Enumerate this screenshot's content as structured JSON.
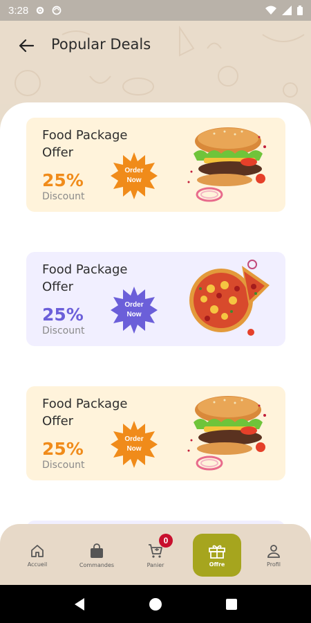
{
  "status_bar": {
    "time": "3:28"
  },
  "header": {
    "title": "Popular Deals"
  },
  "deals": [
    {
      "title": "Food Package Offer",
      "percent": "25%",
      "discount_label": "Discount",
      "badge_line1": "Order",
      "badge_line2": "Now",
      "theme": "orange",
      "food": "burger"
    },
    {
      "title": "Food Package Offer",
      "percent": "25%",
      "discount_label": "Discount",
      "badge_line1": "Order",
      "badge_line2": "Now",
      "theme": "purple",
      "food": "pizza"
    },
    {
      "title": "Food Package Offer",
      "percent": "25%",
      "discount_label": "Discount",
      "badge_line1": "Order",
      "badge_line2": "Now",
      "theme": "orange",
      "food": "burger"
    }
  ],
  "bottom_nav": {
    "items": [
      {
        "label": "Accueil",
        "icon": "home-icon"
      },
      {
        "label": "Commandes",
        "icon": "shopping-bag-icon"
      },
      {
        "label": "Panier",
        "icon": "cart-icon",
        "badge": "0"
      },
      {
        "label": "Offre",
        "icon": "gift-icon",
        "active": true
      },
      {
        "label": "Profil",
        "icon": "profile-icon"
      }
    ]
  },
  "colors": {
    "accent_orange": "#f08b1a",
    "accent_purple": "#6b5fd9",
    "active_nav": "#a6a51e",
    "badge_red": "#c8102e"
  }
}
